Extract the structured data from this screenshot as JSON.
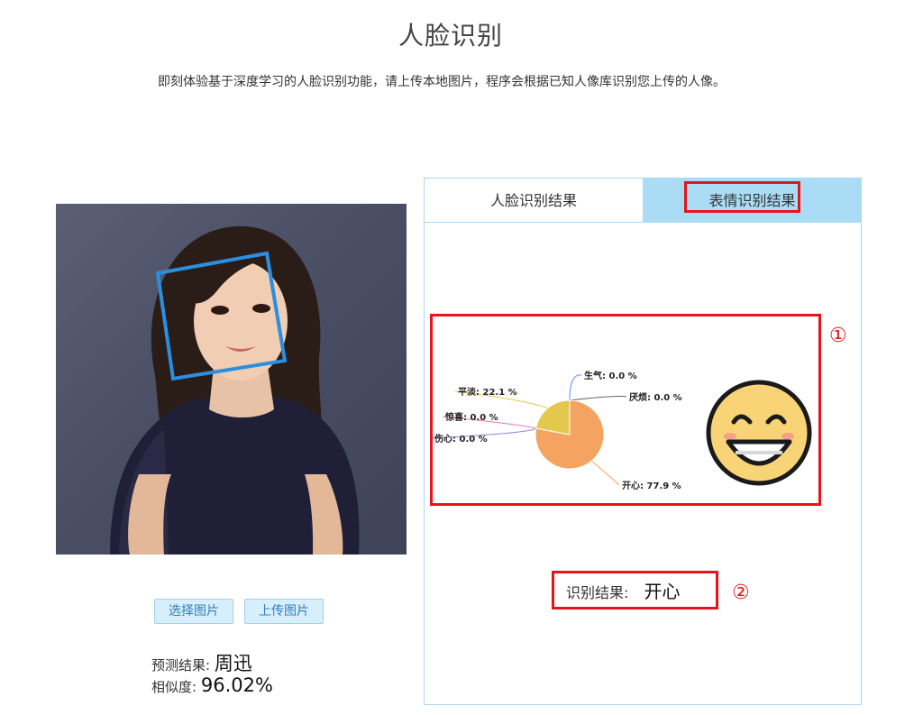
{
  "header": {
    "title": "人脸识别",
    "description": "即刻体验基于深度学习的人脸识别功能，请上传本地图片，程序会根据已知人像库识别您上传的人像。"
  },
  "left": {
    "buttons": {
      "select": "选择图片",
      "upload": "上传图片"
    },
    "prediction_label": "预测结果:",
    "prediction_value": "周迅",
    "similarity_label": "相似度:",
    "similarity_value": "96.02%"
  },
  "panel": {
    "tabs": [
      "人脸识别结果",
      "表情识别结果"
    ],
    "active_tab": 1,
    "result_label": "识别结果:",
    "result_value": "开心"
  },
  "annotations": {
    "marker1": "①",
    "marker2": "②"
  },
  "colors": {
    "highlight": "#e8141b",
    "tab_active": "#aadcf6",
    "face_box": "#2a8fe0"
  },
  "chart_data": {
    "type": "pie",
    "slices": [
      {
        "name": "生气",
        "value": 0.0,
        "label": "生气: 0.0 %",
        "color": "#5b8ff9"
      },
      {
        "name": "厌烦",
        "value": 0.0,
        "label": "厌烦: 0.0 %",
        "color": "#666666"
      },
      {
        "name": "开心",
        "value": 77.9,
        "label": "开心: 77.9 %",
        "color": "#f4a460"
      },
      {
        "name": "伤心",
        "value": 0.0,
        "label": "伤心: 0.0 %",
        "color": "#9b7ed9"
      },
      {
        "name": "惊喜",
        "value": 0.0,
        "label": "惊喜: 0.0 %",
        "color": "#e87ab0"
      },
      {
        "name": "平淡",
        "value": 22.1,
        "label": "平淡: 22.1 %",
        "color": "#e3c84e"
      }
    ]
  }
}
